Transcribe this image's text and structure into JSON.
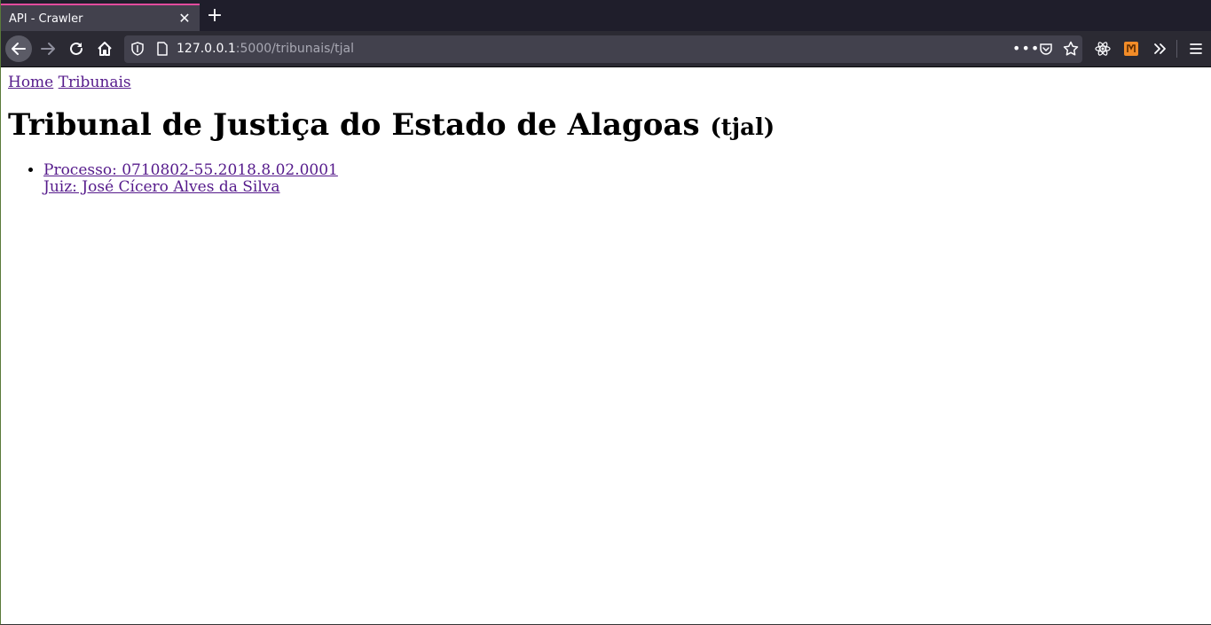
{
  "browser": {
    "tab_title": "API - Crawler",
    "url_host": "127.0.0.1",
    "url_path": ":5000/tribunais/tjal",
    "url_dots": "•••",
    "accent": "#e24b9e"
  },
  "page": {
    "nav": {
      "home": "Home",
      "tribunais": "Tribunais"
    },
    "heading": {
      "title": "Tribunal de Justiça do Estado de Alagoas",
      "sigla": "(tjal)"
    },
    "processos": [
      {
        "processo": "Processo: 0710802-55.2018.8.02.0001",
        "juiz": "Juiz: José Cícero Alves da Silva"
      }
    ]
  }
}
